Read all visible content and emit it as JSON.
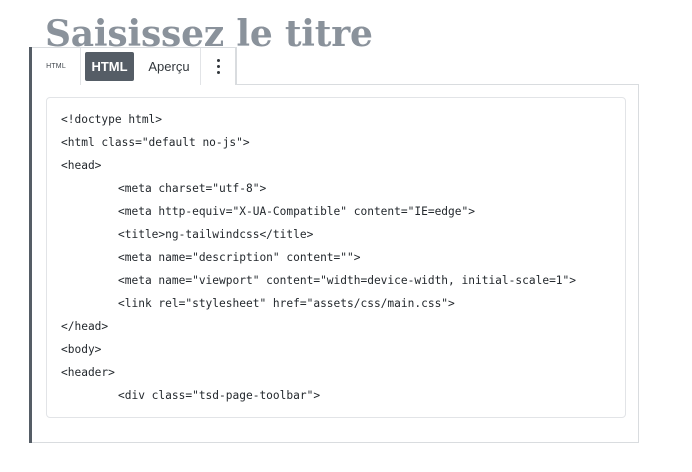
{
  "page": {
    "title": "Saisissez le titre"
  },
  "toolbar": {
    "block_type_label": "HTML",
    "html_tab_label": "HTML",
    "preview_tab_label": "Aperçu",
    "more_icon": "vertical-ellipsis-icon"
  },
  "code": {
    "lines": [
      {
        "text": "<!doctype html>",
        "indent": 0
      },
      {
        "text": "<html class=\"default no-js\">",
        "indent": 0
      },
      {
        "text": "<head>",
        "indent": 0
      },
      {
        "text": "<meta charset=\"utf-8\">",
        "indent": 1
      },
      {
        "text": "<meta http-equiv=\"X-UA-Compatible\" content=\"IE=edge\">",
        "indent": 1
      },
      {
        "text": "<title>ng-tailwindcss</title>",
        "indent": 1
      },
      {
        "text": "<meta name=\"description\" content=\"\">",
        "indent": 1
      },
      {
        "text": "<meta name=\"viewport\" content=\"width=device-width, initial-scale=1\">",
        "indent": 1
      },
      {
        "text": "<link rel=\"stylesheet\" href=\"assets/css/main.css\">",
        "indent": 1
      },
      {
        "text": "</head>",
        "indent": 0
      },
      {
        "text": "<body>",
        "indent": 0
      },
      {
        "text": "<header>",
        "indent": 0
      },
      {
        "text": "<div class=\"tsd-page-toolbar\">",
        "indent": 1
      }
    ]
  },
  "colors": {
    "title": "#8a929b",
    "active_tab_bg": "#555d66",
    "active_tab_text": "#ffffff",
    "block_left_border": "#555d66"
  }
}
